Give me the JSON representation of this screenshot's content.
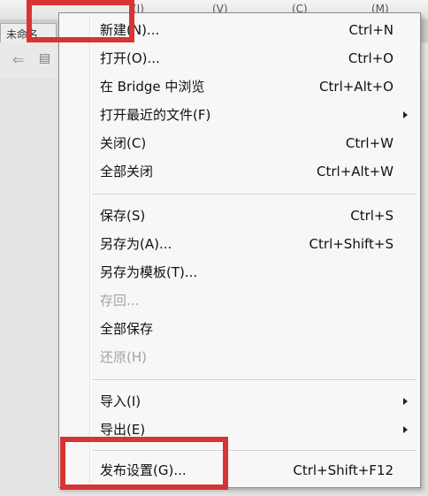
{
  "menu": {
    "items": [
      {
        "label": "新建(N)...",
        "shortcut": "Ctrl+N",
        "enabled": true
      },
      {
        "label": "打开(O)...",
        "shortcut": "Ctrl+O",
        "enabled": true
      },
      {
        "label": "在 Bridge 中浏览",
        "shortcut": "Ctrl+Alt+O",
        "enabled": true
      },
      {
        "label": "打开最近的文件(F)",
        "shortcut": "",
        "submenu": true,
        "enabled": true
      },
      {
        "label": "关闭(C)",
        "shortcut": "Ctrl+W",
        "enabled": true
      },
      {
        "label": "全部关闭",
        "shortcut": "Ctrl+Alt+W",
        "enabled": true
      },
      {
        "label": "保存(S)",
        "shortcut": "Ctrl+S",
        "enabled": true
      },
      {
        "label": "另存为(A)...",
        "shortcut": "Ctrl+Shift+S",
        "enabled": true
      },
      {
        "label": "另存为模板(T)...",
        "shortcut": "",
        "enabled": true
      },
      {
        "label": "存回...",
        "shortcut": "",
        "enabled": false
      },
      {
        "label": "全部保存",
        "shortcut": "",
        "enabled": true
      },
      {
        "label": "还原(H)",
        "shortcut": "",
        "enabled": false
      },
      {
        "label": "导入(I)",
        "shortcut": "",
        "submenu": true,
        "enabled": true
      },
      {
        "label": "导出(E)",
        "shortcut": "",
        "submenu": true,
        "enabled": true
      },
      {
        "label": "发布设置(G)...",
        "shortcut": "Ctrl+Shift+F12",
        "enabled": true
      }
    ]
  },
  "colors": {
    "highlight": "#d83434",
    "menu_background": "#f7f7f7",
    "disabled_text": "#a3a3a3"
  },
  "icons": {
    "back": "back-arrow-icon",
    "submenu": "submenu-arrow-icon"
  }
}
